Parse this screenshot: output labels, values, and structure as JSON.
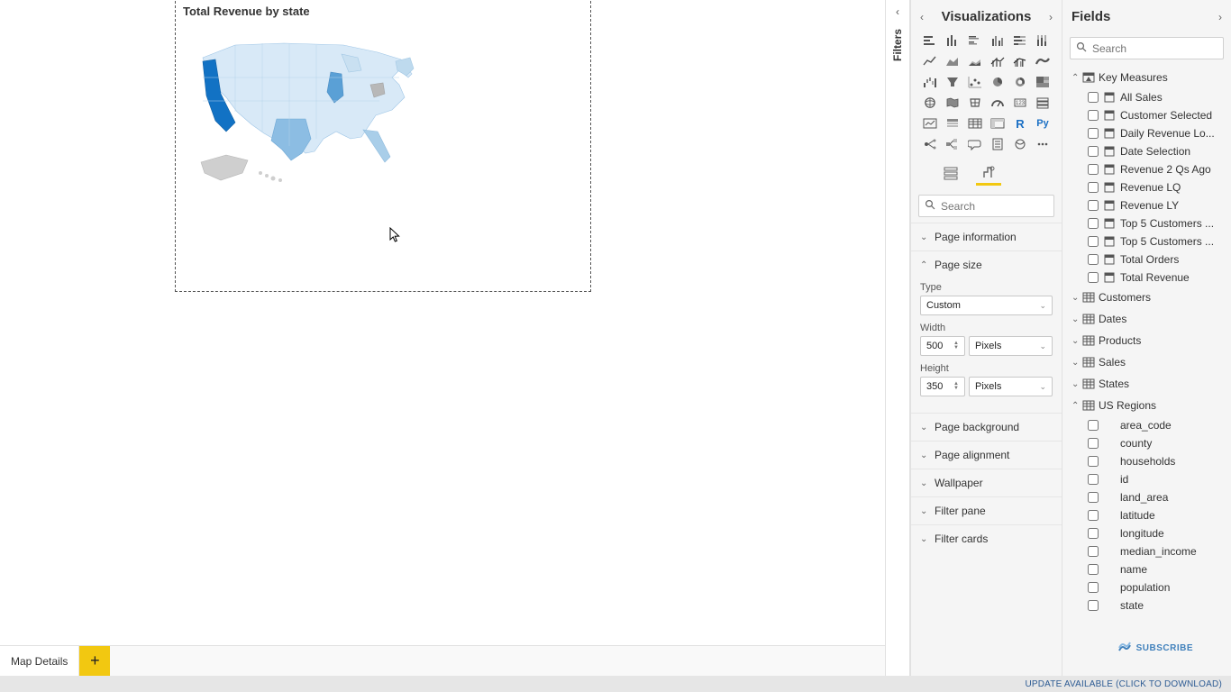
{
  "canvas": {
    "visual_title": "Total Revenue by state",
    "active_tab": "Map Details"
  },
  "filters_label": "Filters",
  "visualizations": {
    "title": "Visualizations",
    "search_placeholder": "Search",
    "sections": {
      "page_information": "Page information",
      "page_size": "Page size",
      "type_label": "Type",
      "type_value": "Custom",
      "width_label": "Width",
      "width_value": "500",
      "width_unit": "Pixels",
      "height_label": "Height",
      "height_value": "350",
      "height_unit": "Pixels",
      "page_background": "Page background",
      "page_alignment": "Page alignment",
      "wallpaper": "Wallpaper",
      "filter_pane": "Filter pane",
      "filter_cards": "Filter cards"
    }
  },
  "fields": {
    "title": "Fields",
    "search_placeholder": "Search",
    "groups": [
      {
        "name": "Key Measures",
        "expanded": true,
        "is_measure_table": true,
        "items": [
          {
            "label": "All Sales",
            "type": "measure"
          },
          {
            "label": "Customer Selected",
            "type": "measure"
          },
          {
            "label": "Daily Revenue Lo...",
            "type": "measure"
          },
          {
            "label": "Date Selection",
            "type": "measure"
          },
          {
            "label": "Revenue 2 Qs Ago",
            "type": "measure"
          },
          {
            "label": "Revenue LQ",
            "type": "measure"
          },
          {
            "label": "Revenue LY",
            "type": "measure"
          },
          {
            "label": "Top 5 Customers ...",
            "type": "measure"
          },
          {
            "label": "Top 5 Customers ...",
            "type": "measure"
          },
          {
            "label": "Total Orders",
            "type": "measure"
          },
          {
            "label": "Total Revenue",
            "type": "measure"
          }
        ]
      },
      {
        "name": "Customers",
        "expanded": false
      },
      {
        "name": "Dates",
        "expanded": false
      },
      {
        "name": "Products",
        "expanded": false
      },
      {
        "name": "Sales",
        "expanded": false
      },
      {
        "name": "States",
        "expanded": false
      },
      {
        "name": "US Regions",
        "expanded": true,
        "items": [
          {
            "label": "area_code",
            "type": "column"
          },
          {
            "label": "county",
            "type": "column"
          },
          {
            "label": "households",
            "type": "column"
          },
          {
            "label": "id",
            "type": "column"
          },
          {
            "label": "land_area",
            "type": "column"
          },
          {
            "label": "latitude",
            "type": "column"
          },
          {
            "label": "longitude",
            "type": "column"
          },
          {
            "label": "median_income",
            "type": "column"
          },
          {
            "label": "name",
            "type": "column"
          },
          {
            "label": "population",
            "type": "column"
          },
          {
            "label": "state",
            "type": "column"
          }
        ]
      }
    ]
  },
  "status_bar": "UPDATE AVAILABLE (CLICK TO DOWNLOAD)",
  "subscribe": "SUBSCRIBE",
  "chart_data": {
    "type": "choropleth-map",
    "title": "Total Revenue by state",
    "region": "United States",
    "color_scale": "Blues",
    "notes": "US states shaded by Total Revenue; California darkest (highest), Texas/Illinois medium-high, most others light. Exact values not rendered on map."
  }
}
